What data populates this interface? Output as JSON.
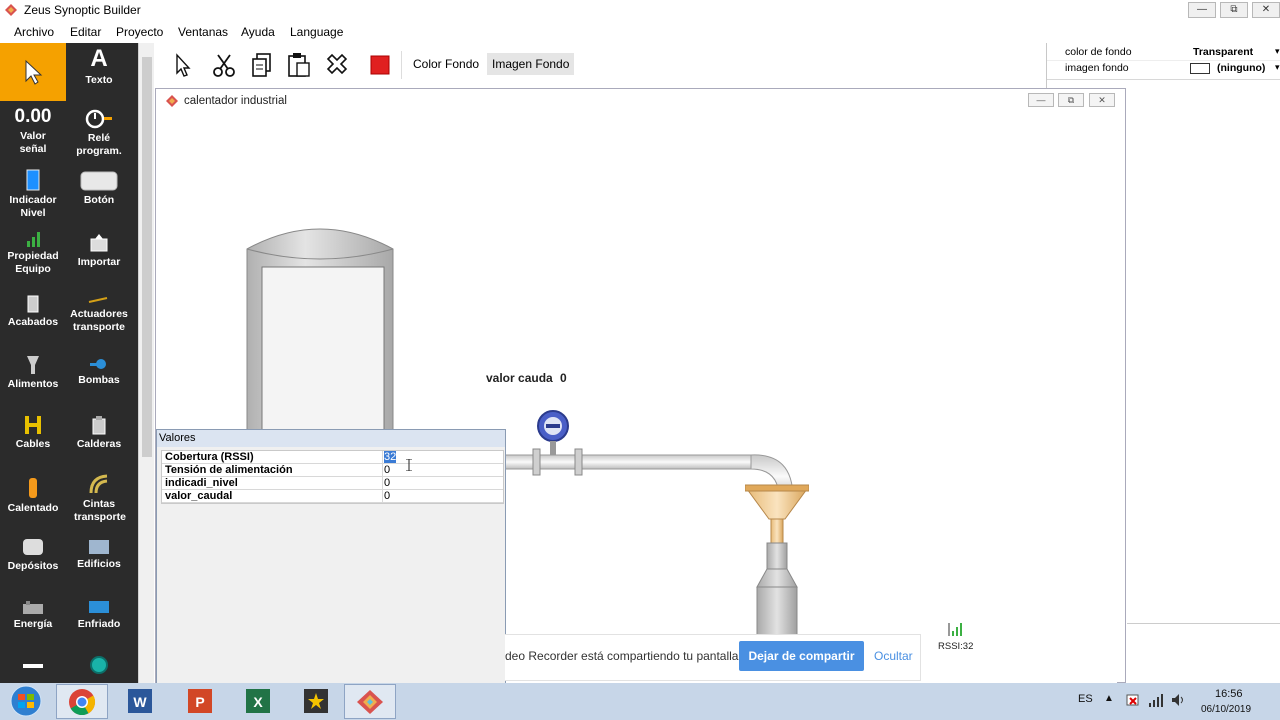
{
  "window": {
    "title": "Zeus Synoptic Builder",
    "controls": [
      "minimize",
      "restore",
      "close"
    ]
  },
  "menu": [
    "Archivo",
    "Editar",
    "Proyecto",
    "Ventanas",
    "Ayuda",
    "Language"
  ],
  "palette": {
    "items": [
      {
        "label": "",
        "icon": "pointer-icon"
      },
      {
        "label": "Texto",
        "icon": "text-icon"
      },
      {
        "label": "Valor señal",
        "icon": "signal-value-icon",
        "value": "0.00"
      },
      {
        "label": "Relé program.",
        "icon": "timer-relay-icon"
      },
      {
        "label": "Indicador Nivel",
        "icon": "level-indicator-icon"
      },
      {
        "label": "Botón",
        "icon": "button-icon"
      },
      {
        "label": "Propiedad Equipo",
        "icon": "signal-bars-icon"
      },
      {
        "label": "Importar",
        "icon": "import-icon"
      },
      {
        "label": "Acabados",
        "icon": "finishing-icon"
      },
      {
        "label": "Actuadores transporte",
        "icon": "actuator-icon"
      },
      {
        "label": "Alimentos",
        "icon": "funnel-icon"
      },
      {
        "label": "Bombas",
        "icon": "pump-icon"
      },
      {
        "label": "Cables",
        "icon": "cable-icon"
      },
      {
        "label": "Calderas",
        "icon": "boiler-icon"
      },
      {
        "label": "Calentado",
        "icon": "heater-icon"
      },
      {
        "label": "Cintas transporte",
        "icon": "conveyor-icon"
      },
      {
        "label": "Depósitos",
        "icon": "tank-icon"
      },
      {
        "label": "Edificios",
        "icon": "building-icon"
      },
      {
        "label": "Energía",
        "icon": "energy-icon"
      },
      {
        "label": "Enfriado",
        "icon": "cooler-icon"
      },
      {
        "label": "",
        "icon": "arrow-icon"
      },
      {
        "label": "",
        "icon": "circle-icon"
      }
    ]
  },
  "toolbar": {
    "color_fondo": "Color Fondo",
    "imagen_fondo": "Imagen Fondo",
    "icons": [
      "select-icon",
      "cut-icon",
      "copy-icon",
      "paste-icon",
      "delete-icon",
      "red-square-icon"
    ]
  },
  "properties": {
    "rows": [
      {
        "name": "color de fondo",
        "value": "Transparent"
      },
      {
        "name": "imagen fondo",
        "value": "(ninguno)"
      }
    ]
  },
  "child_window": {
    "title": "calentador industrial",
    "label_valor_cauda": "valor cauda",
    "valor_cauda_value": "0",
    "rssi_label": "RSSI:32"
  },
  "valores": {
    "header": "Valores",
    "rows": [
      {
        "name": "Cobertura (RSSI)",
        "value": "32"
      },
      {
        "name": "Tensión de alimentación",
        "value": "0"
      },
      {
        "name": "indicadi_nivel",
        "value": "0"
      },
      {
        "name": "valor_caudal",
        "value": "0"
      }
    ]
  },
  "share_bar": {
    "message": "deo Recorder está compartiendo tu pantalla.",
    "stop_button": "Dejar de compartir",
    "hide_link": "Ocultar"
  },
  "taskbar": {
    "language": "ES",
    "time": "16:56",
    "date": "06/10/2019",
    "apps": [
      "start",
      "chrome",
      "word",
      "powerpoint",
      "excel",
      "star-app",
      "zeus"
    ]
  },
  "colors": {
    "palette_bg": "#2b2b2b",
    "palette_selected": "#f5a100",
    "accent_blue": "#4a90e2",
    "taskbar": "#c7d6e8"
  }
}
